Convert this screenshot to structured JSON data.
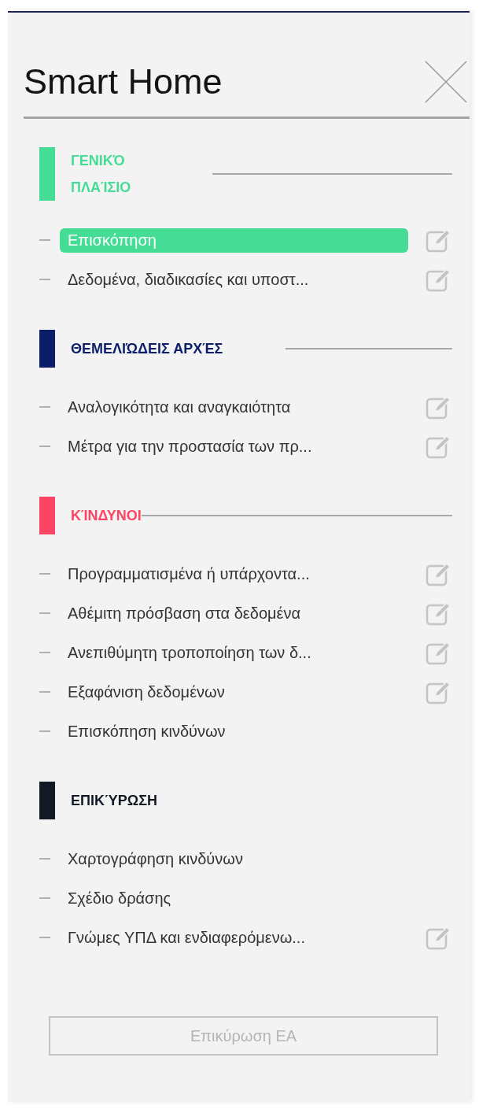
{
  "panel": {
    "title": "Smart Home"
  },
  "sections": [
    {
      "heading": "ΓΕΝΙΚΌ ΠΛΑΊΣΙΟ",
      "color": "#45dc95",
      "rule": true,
      "items": [
        {
          "label": "Επισκόπηση",
          "selected": true,
          "editable": true
        },
        {
          "label": "Δεδομένα, διαδικασίες και υποστ...",
          "selected": false,
          "editable": true
        }
      ]
    },
    {
      "heading": "ΘΕΜΕΛΙΏΔΕΙΣ ΑΡΧΈΣ",
      "color": "#0c1e6a",
      "rule": true,
      "items": [
        {
          "label": "Αναλογικότητα και αναγκαιότητα",
          "selected": false,
          "editable": true
        },
        {
          "label": "Μέτρα για την προστασία των πρ...",
          "selected": false,
          "editable": true
        }
      ]
    },
    {
      "heading": "ΚΊΝΔΥΝΟΙ",
      "color": "#fc4464",
      "rule": true,
      "items": [
        {
          "label": "Προγραμματισμένα ή υπάρχοντα...",
          "selected": false,
          "editable": true
        },
        {
          "label": "Αθέμιτη πρόσβαση στα δεδομένα",
          "selected": false,
          "editable": true
        },
        {
          "label": "Ανεπιθύμητη τροποποίηση των δ...",
          "selected": false,
          "editable": true
        },
        {
          "label": "Εξαφάνιση δεδομένων",
          "selected": false,
          "editable": true
        },
        {
          "label": "Επισκόπηση κινδύνων",
          "selected": false,
          "editable": false
        }
      ]
    },
    {
      "heading": "ΕΠΙΚΎΡΩΣΗ",
      "color": "#111a24",
      "rule": false,
      "items": [
        {
          "label": "Χαρτογράφηση κινδύνων",
          "selected": false,
          "editable": false
        },
        {
          "label": "Σχέδιο δράσης",
          "selected": false,
          "editable": false
        },
        {
          "label": "Γνώμες ΥΠΔ και ενδιαφερόμενω...",
          "selected": false,
          "editable": true
        }
      ]
    }
  ],
  "footer_button": {
    "label": "Επικύρωση ΕΑ",
    "disabled": true
  }
}
